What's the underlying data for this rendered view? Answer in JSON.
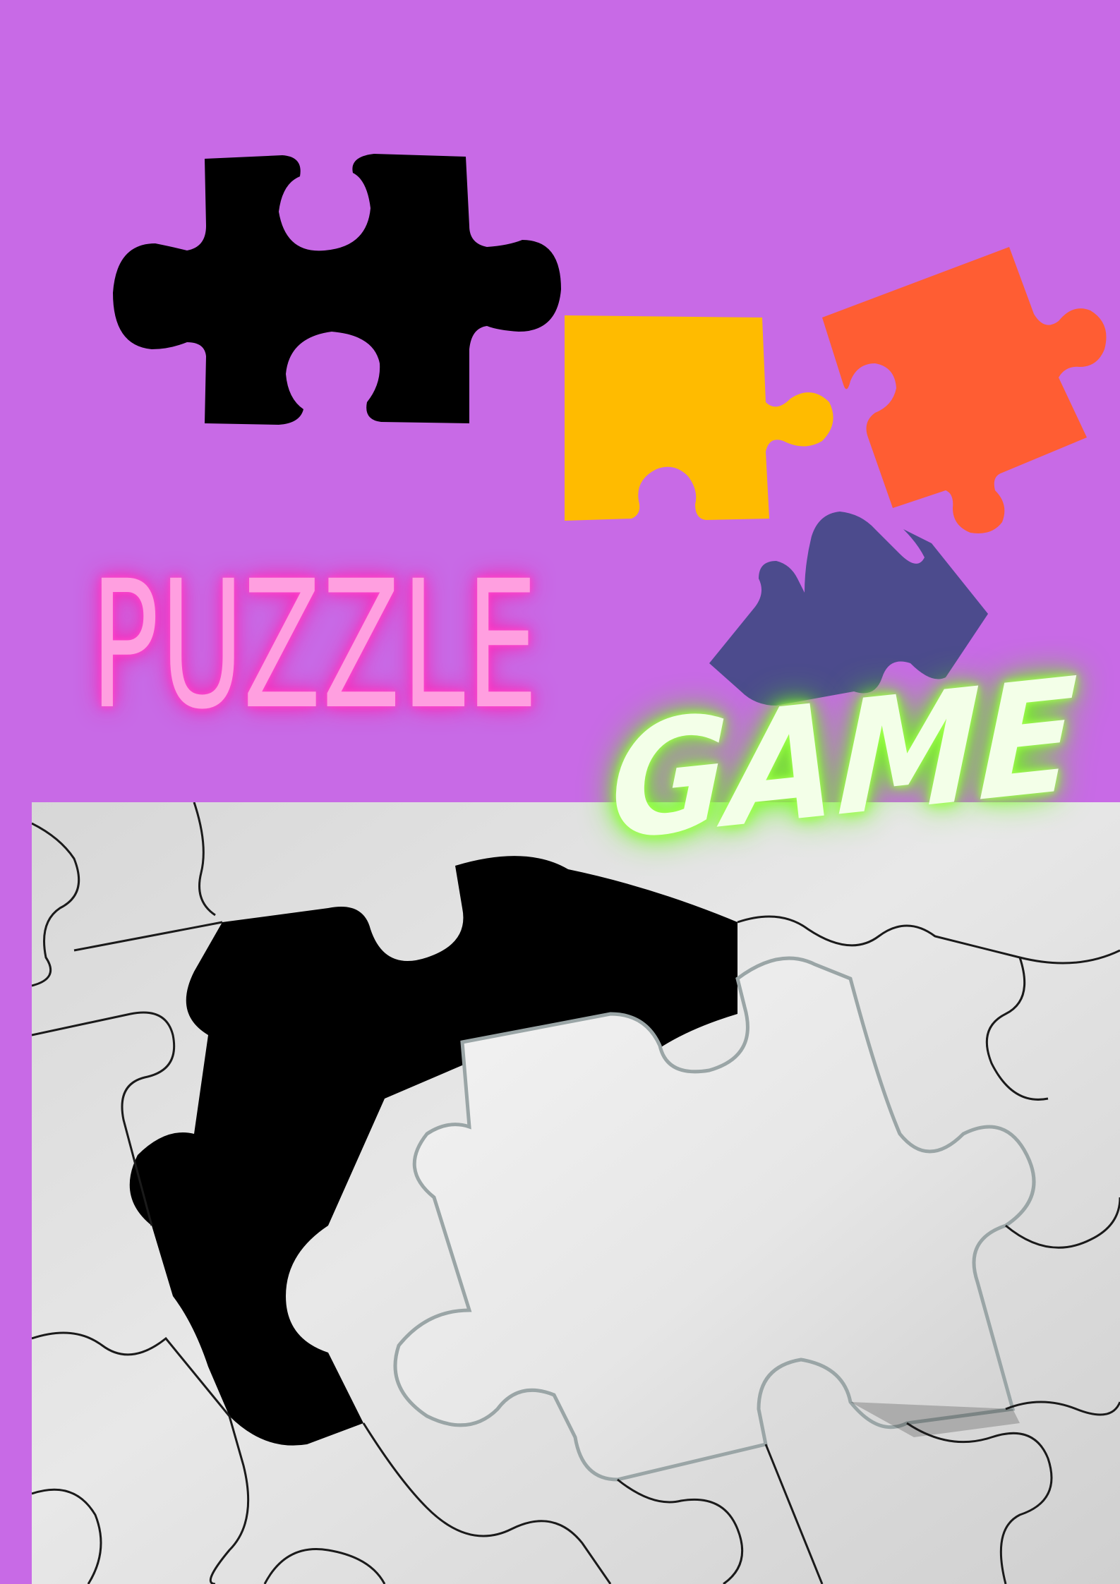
{
  "poster": {
    "title_word_1": "PUZZLE",
    "title_word_2": "GAME"
  },
  "colors": {
    "background": "#c86ae6",
    "piece_black": "#000000",
    "piece_yellow": "#ffbb00",
    "piece_orange": "#ff5d33",
    "piece_navy": "#4c4b8d",
    "title_pink": "#ff9fe0",
    "title_pink_glow": "#ff2fc0",
    "title_green": "#f3ffe8",
    "title_green_glow": "#86ff2a",
    "photo_paper": "#dcdcdc",
    "photo_hole": "#000000"
  },
  "icons": [
    "jigsaw-piece-icon",
    "jigsaw-piece-icon",
    "jigsaw-piece-icon",
    "jigsaw-piece-icon"
  ]
}
